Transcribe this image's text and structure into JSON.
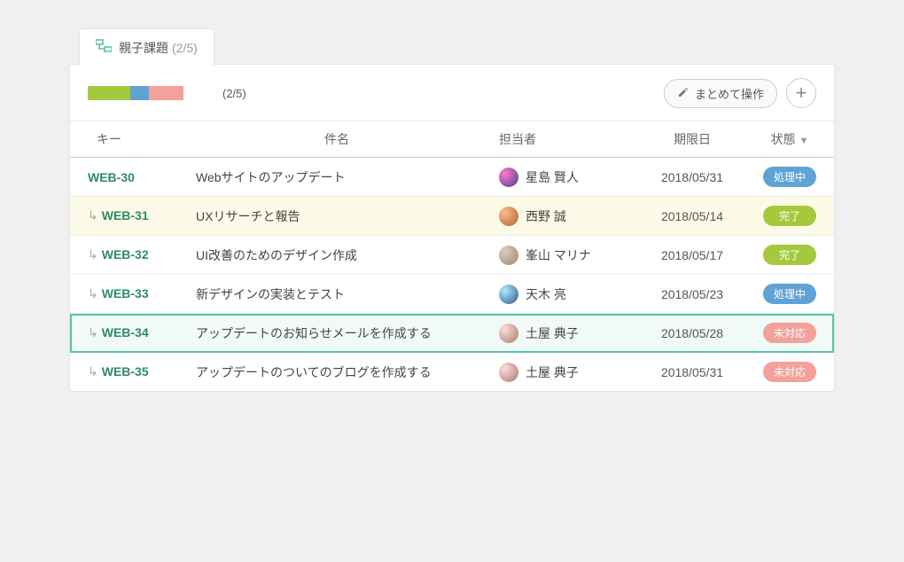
{
  "tab": {
    "label": "親子課題",
    "count": "(2/5)"
  },
  "toolbar": {
    "progress": {
      "green": 34,
      "blue": 15,
      "pink": 28,
      "count": "(2/5)"
    },
    "bulk_label": "まとめて操作",
    "add_label": "+"
  },
  "columns": {
    "key": "キー",
    "subject": "件名",
    "assignee": "担当者",
    "due": "期限日",
    "state": "状態"
  },
  "status_labels": {
    "processing": "処理中",
    "done": "完了",
    "pending": "未対応"
  },
  "rows": [
    {
      "key": "WEB-30",
      "child": false,
      "subject": "Webサイトのアップデート",
      "assignee": "星島 賢人",
      "avatar": "av1",
      "due": "2018/05/31",
      "status": "processing",
      "mode": ""
    },
    {
      "key": "WEB-31",
      "child": true,
      "subject": "UXリサーチと報告",
      "assignee": "西野 誠",
      "avatar": "av2",
      "due": "2018/05/14",
      "status": "done",
      "mode": "highlighted"
    },
    {
      "key": "WEB-32",
      "child": true,
      "subject": "UI改善のためのデザイン作成",
      "assignee": "峯山 マリナ",
      "avatar": "av3",
      "due": "2018/05/17",
      "status": "done",
      "mode": ""
    },
    {
      "key": "WEB-33",
      "child": true,
      "subject": "新デザインの実装とテスト",
      "assignee": "天木 亮",
      "avatar": "av4",
      "due": "2018/05/23",
      "status": "processing",
      "mode": ""
    },
    {
      "key": "WEB-34",
      "child": true,
      "subject": "アップデートのお知らせメールを作成する",
      "assignee": "土屋 典子",
      "avatar": "av5",
      "due": "2018/05/28",
      "status": "pending",
      "mode": "selected"
    },
    {
      "key": "WEB-35",
      "child": true,
      "subject": "アップデートのついてのブログを作成する",
      "assignee": "土屋 典子",
      "avatar": "av5",
      "due": "2018/05/31",
      "status": "pending",
      "mode": ""
    }
  ]
}
